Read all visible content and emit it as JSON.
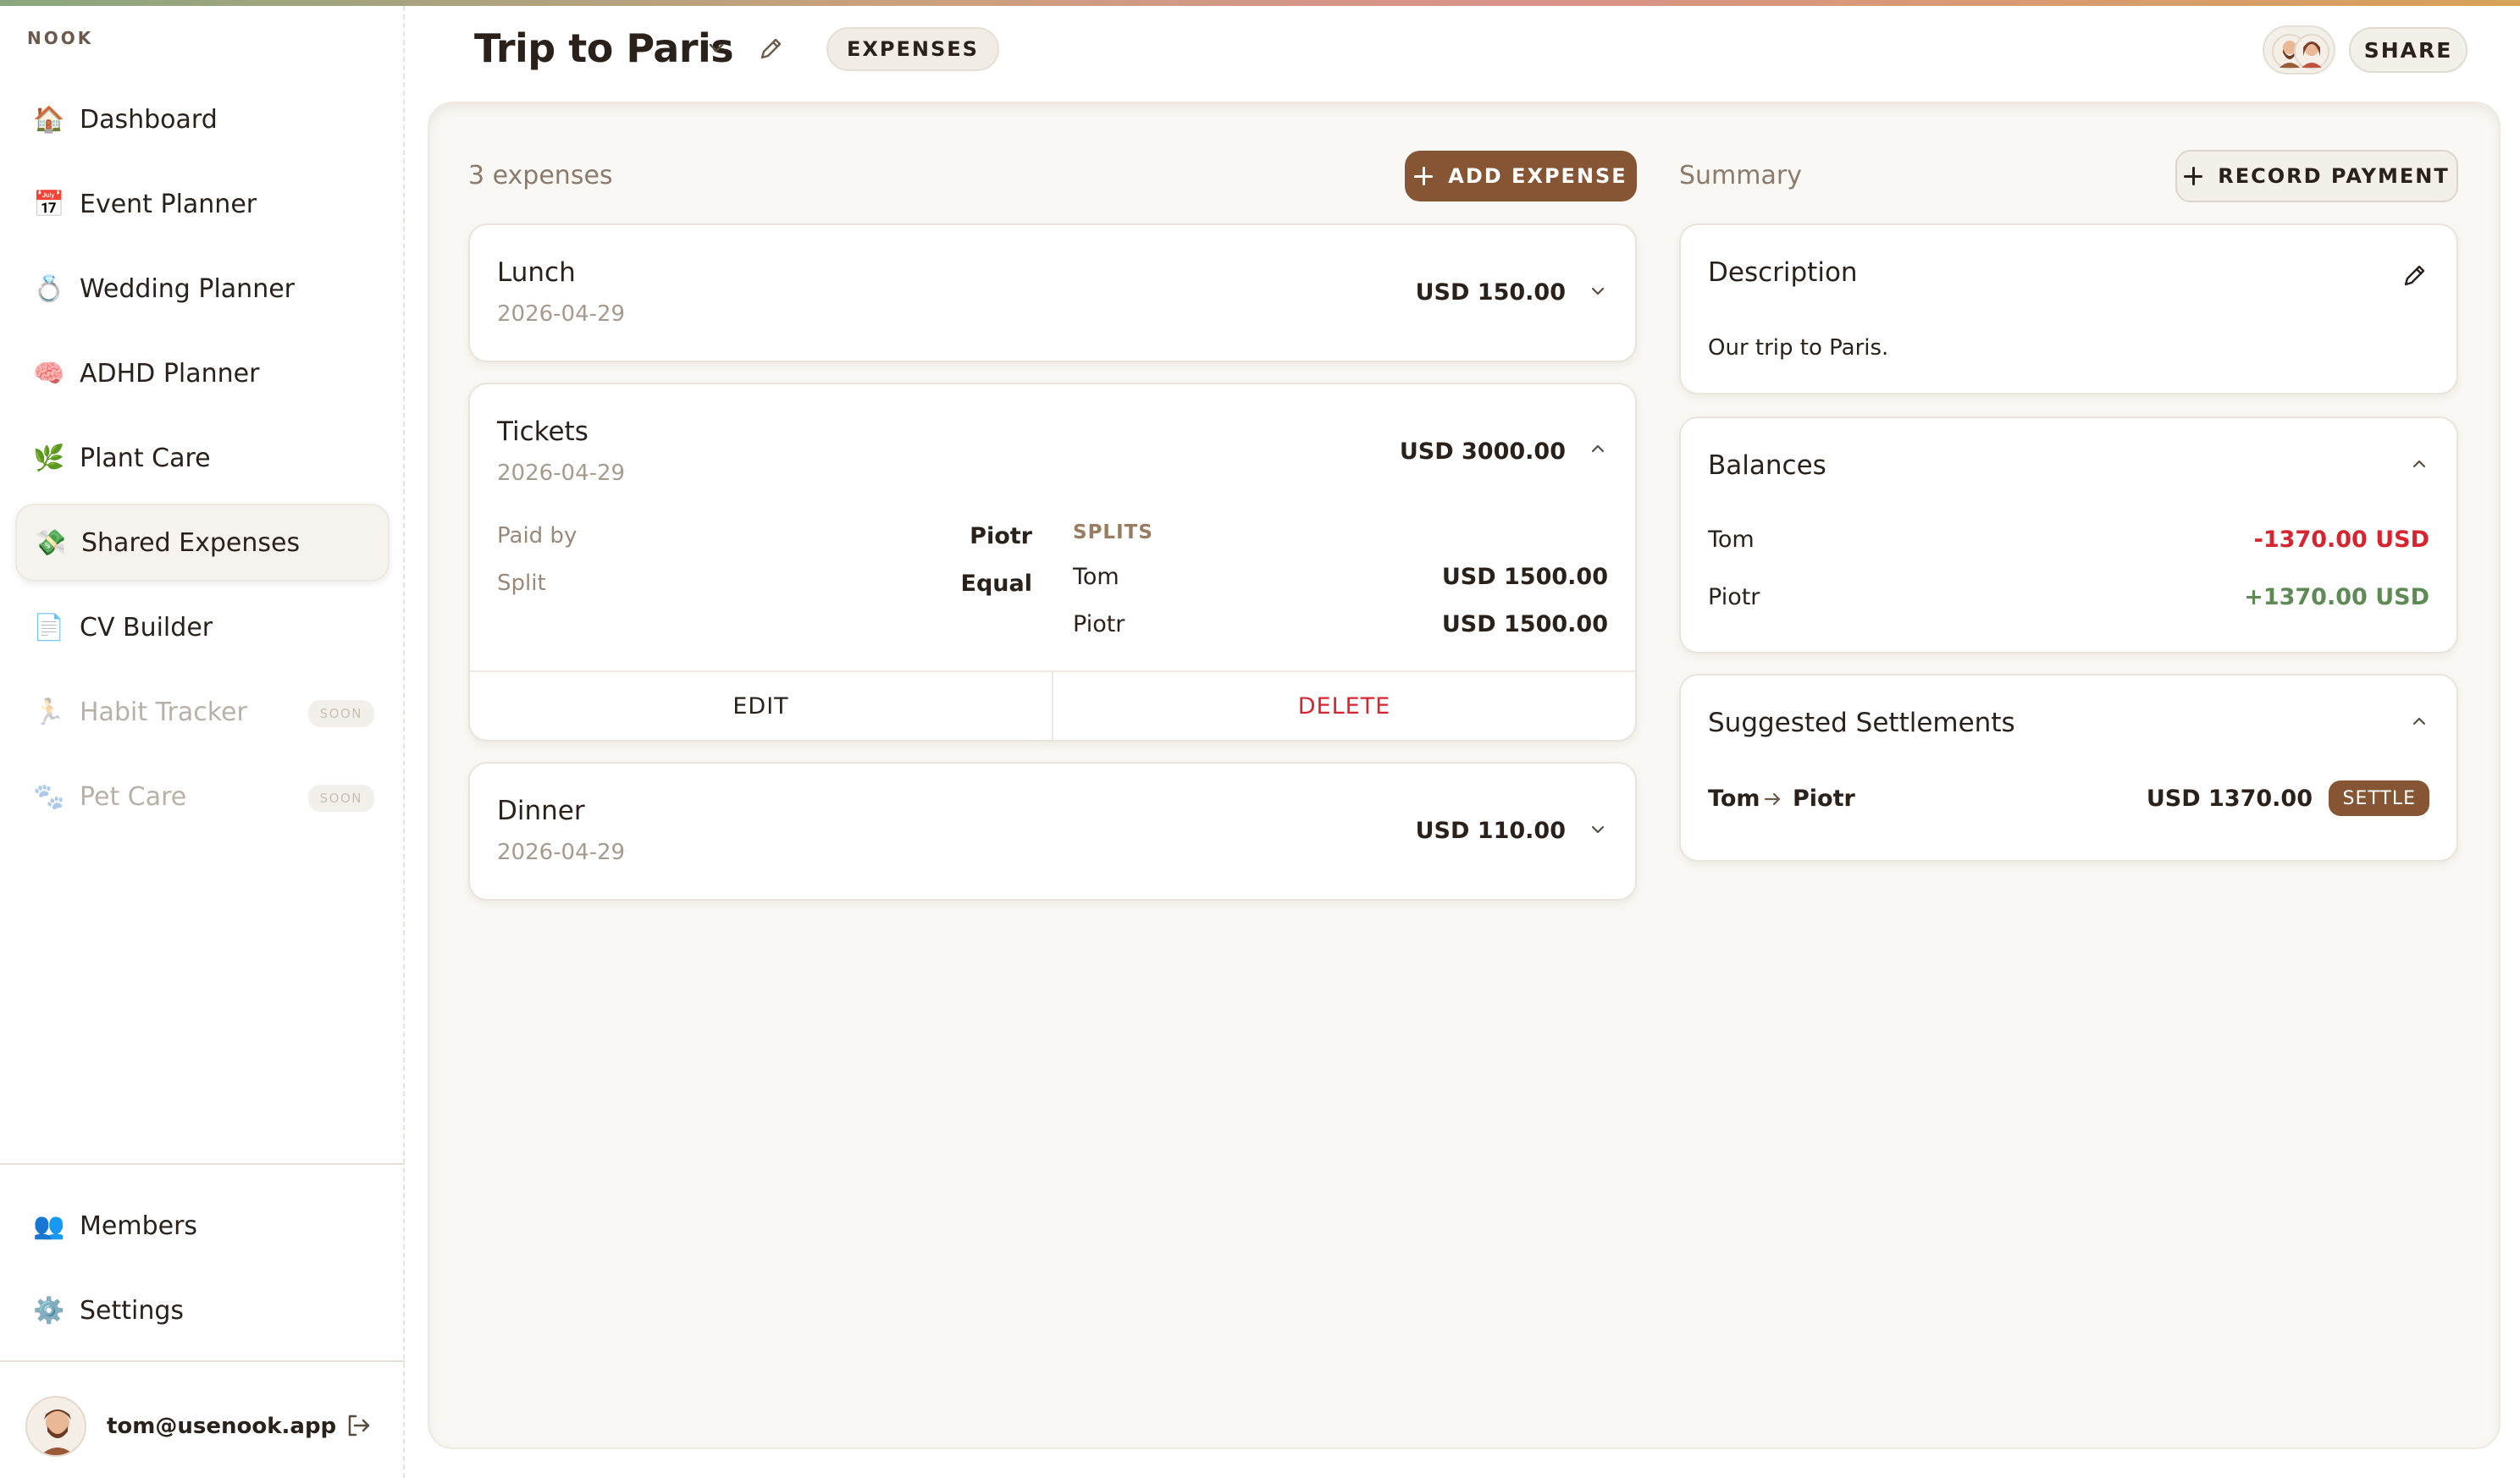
{
  "brand": "NOOK",
  "nav": {
    "items": [
      {
        "label": "Dashboard",
        "icon": "🏠",
        "icon_name": "house-icon"
      },
      {
        "label": "Event Planner",
        "icon": "📅",
        "icon_name": "calendar-icon"
      },
      {
        "label": "Wedding Planner",
        "icon": "💍",
        "icon_name": "ring-icon"
      },
      {
        "label": "ADHD Planner",
        "icon": "🧠",
        "icon_name": "brain-icon"
      },
      {
        "label": "Plant Care",
        "icon": "🌿",
        "icon_name": "herb-icon"
      },
      {
        "label": "Shared Expenses",
        "icon": "💸",
        "icon_name": "money-wings-icon"
      },
      {
        "label": "CV Builder",
        "icon": "📄",
        "icon_name": "document-icon"
      },
      {
        "label": "Habit Tracker",
        "icon": "🏃",
        "icon_name": "runner-icon",
        "badge": "SOON"
      },
      {
        "label": "Pet Care",
        "icon": "🐾",
        "icon_name": "paw-icon",
        "badge": "SOON"
      }
    ],
    "bottom": [
      {
        "label": "Members",
        "icon": "👥",
        "icon_name": "members-icon"
      },
      {
        "label": "Settings",
        "icon": "⚙️",
        "icon_name": "gear-icon"
      }
    ]
  },
  "user": {
    "email": "tom@usenook.app"
  },
  "header": {
    "title": "Trip to Paris",
    "section_pill": "EXPENSES",
    "share_label": "SHARE"
  },
  "expenses": {
    "count_label": "3 expenses",
    "add_label": "ADD EXPENSE",
    "items": [
      {
        "name": "Lunch",
        "date": "2026-04-29",
        "amount": "USD 150.00"
      },
      {
        "name": "Tickets",
        "date": "2026-04-29",
        "amount": "USD 3000.00",
        "paid_by_label": "Paid by",
        "paid_by": "Piotr",
        "split_label": "Split",
        "split": "Equal",
        "splits_heading": "SPLITS",
        "splits": [
          {
            "name": "Tom",
            "amount": "USD 1500.00"
          },
          {
            "name": "Piotr",
            "amount": "USD 1500.00"
          }
        ],
        "edit_label": "EDIT",
        "delete_label": "DELETE"
      },
      {
        "name": "Dinner",
        "date": "2026-04-29",
        "amount": "USD 110.00"
      }
    ]
  },
  "summary": {
    "label": "Summary",
    "record_label": "RECORD PAYMENT",
    "description_title": "Description",
    "description_text": "Our trip to Paris.",
    "balances_title": "Balances",
    "balances": [
      {
        "name": "Tom",
        "amount": "-1370.00 USD",
        "color": "#d8242e"
      },
      {
        "name": "Piotr",
        "amount": "+1370.00 USD",
        "color": "#5f8a55"
      }
    ],
    "settlements_title": "Suggested Settlements",
    "settlement": {
      "from": "Tom",
      "to": "Piotr",
      "amount": "USD 1370.00",
      "action": "SETTLE"
    }
  },
  "colors": {
    "accent": "#855534",
    "negative": "#d8242e",
    "positive": "#5f8a55"
  }
}
